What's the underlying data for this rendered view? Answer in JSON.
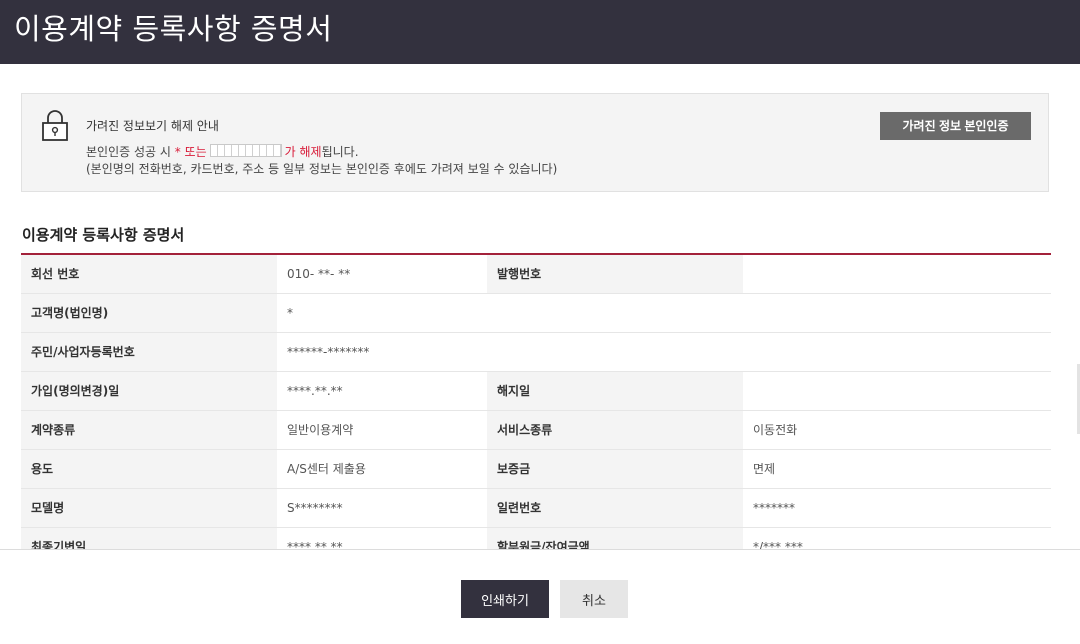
{
  "header": {
    "title": "이용계약 등록사항 증명서"
  },
  "notice": {
    "icon": "lock-icon",
    "title": "가려진 정보보기 해제 안내",
    "line1_prefix": "본인인증 성공 시 ",
    "line1_star_or": "* 또는",
    "line1_release": "가 해제",
    "line1_suffix": "됩니다.",
    "line2": "(본인명의 전화번호, 카드번호, 주소 등 일부 정보는 본인인증 후에도 가려져 보일 수 있습니다)",
    "auth_button": "가려진 정보 본인인증"
  },
  "section_title": "이용계약 등록사항 증명서",
  "table": {
    "rows": [
      {
        "cells": [
          {
            "label": "회선 번호",
            "value": "010-    **-    **"
          },
          {
            "label": "발행번호",
            "value": ""
          }
        ]
      },
      {
        "cells": [
          {
            "label": "고객명(법인명)",
            "value": "*"
          }
        ]
      },
      {
        "cells": [
          {
            "label": "주민/사업자등록번호",
            "value": "******-*******"
          }
        ]
      },
      {
        "cells": [
          {
            "label": "가입(명의변경)일",
            "value": "****.**.**"
          },
          {
            "label": "해지일",
            "value": ""
          }
        ]
      },
      {
        "cells": [
          {
            "label": "계약종류",
            "value": "일반이용계약"
          },
          {
            "label": "서비스종류",
            "value": "이동전화"
          }
        ]
      },
      {
        "cells": [
          {
            "label": "용도",
            "value": "A/S센터 제출용"
          },
          {
            "label": "보증금",
            "value": "면제"
          }
        ]
      },
      {
        "cells": [
          {
            "label": "모델명",
            "value": "S********"
          },
          {
            "label": "일련번호",
            "value": "*******"
          }
        ]
      },
      {
        "cells": [
          {
            "label": "최종기변일",
            "value": "****.**.**"
          },
          {
            "label": "할부원금/잔여금액",
            "value": "*/***,***"
          }
        ]
      }
    ]
  },
  "footer": {
    "print_button": "인쇄하기",
    "cancel_button": "취소"
  },
  "colors": {
    "header_bg": "#33313e",
    "accent": "#a3213a",
    "highlight": "#d81b38"
  }
}
